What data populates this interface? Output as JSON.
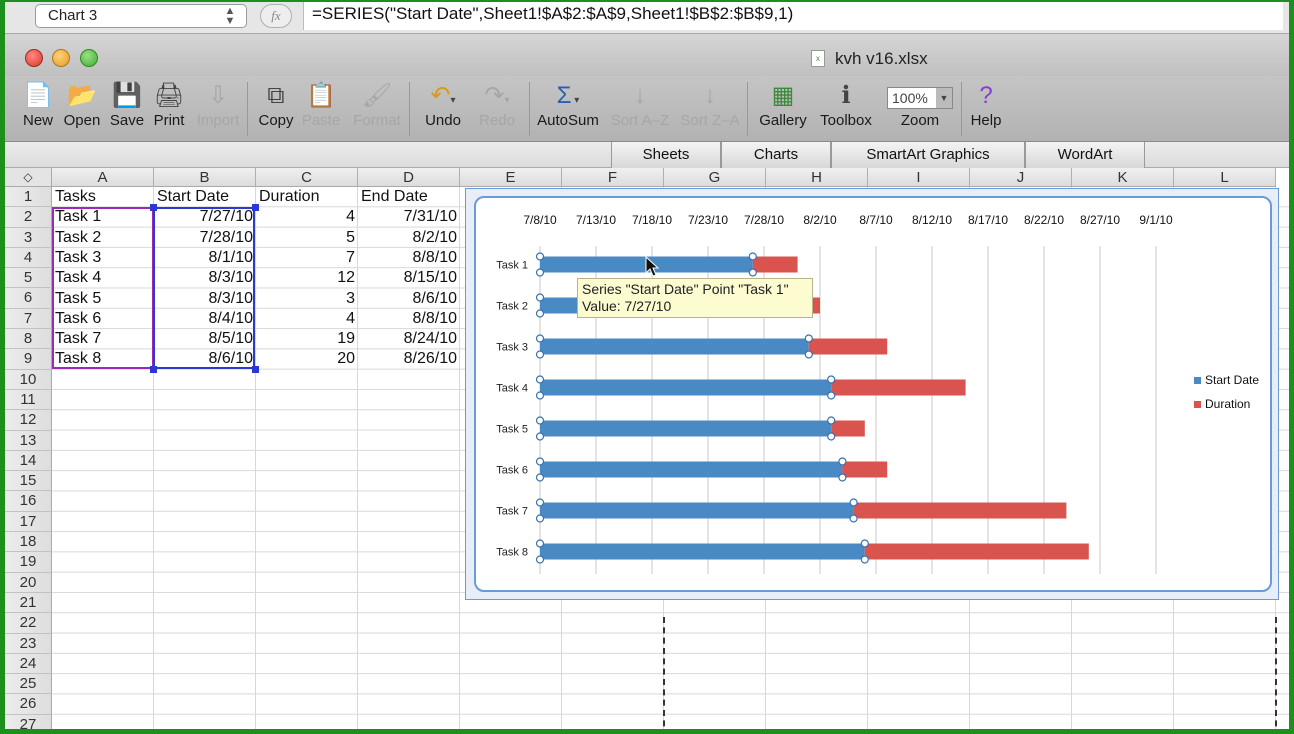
{
  "formula_bar": {
    "name_box": "Chart 3",
    "fx": "fx",
    "formula": "=SERIES(\"Start Date\",Sheet1!$A$2:$A$9,Sheet1!$B$2:$B$9,1)"
  },
  "window": {
    "title": "kvh v16.xlsx"
  },
  "toolbar": {
    "new": "New",
    "open": "Open",
    "save": "Save",
    "print": "Print",
    "import": "Import",
    "copy": "Copy",
    "paste": "Paste",
    "format": "Format",
    "undo": "Undo",
    "redo": "Redo",
    "autosum": "AutoSum",
    "sort_az": "Sort A–Z",
    "sort_za": "Sort Z–A",
    "gallery": "Gallery",
    "toolbox": "Toolbox",
    "zoom_label": "Zoom",
    "zoom_value": "100%",
    "help": "Help"
  },
  "ribbon": {
    "tabs": [
      "Sheets",
      "Charts",
      "SmartArt Graphics",
      "WordArt"
    ]
  },
  "columns": [
    "A",
    "B",
    "C",
    "D",
    "E",
    "F",
    "G",
    "H",
    "I",
    "J",
    "K",
    "L"
  ],
  "rows": [
    "1",
    "2",
    "3",
    "4",
    "5",
    "6",
    "7",
    "8",
    "9",
    "10",
    "11",
    "12",
    "13",
    "14",
    "15",
    "16",
    "17",
    "18",
    "19",
    "20",
    "21",
    "22",
    "23",
    "24",
    "25",
    "26",
    "27"
  ],
  "sheet": {
    "header": [
      "Tasks",
      "Start Date",
      "Duration",
      "End Date"
    ],
    "data": [
      [
        "Task 1",
        "7/27/10",
        "4",
        "7/31/10"
      ],
      [
        "Task 2",
        "7/28/10",
        "5",
        "8/2/10"
      ],
      [
        "Task 3",
        "8/1/10",
        "7",
        "8/8/10"
      ],
      [
        "Task 4",
        "8/3/10",
        "12",
        "8/15/10"
      ],
      [
        "Task 5",
        "8/3/10",
        "3",
        "8/6/10"
      ],
      [
        "Task 6",
        "8/4/10",
        "4",
        "8/8/10"
      ],
      [
        "Task 7",
        "8/5/10",
        "19",
        "8/24/10"
      ],
      [
        "Task 8",
        "8/6/10",
        "20",
        "8/26/10"
      ]
    ]
  },
  "tooltip": {
    "line1": "Series \"Start Date\" Point \"Task 1\"",
    "line2": "Value: 7/27/10"
  },
  "chart_data": {
    "type": "bar",
    "orientation": "horizontal-stacked",
    "categories": [
      "Task 1",
      "Task 2",
      "Task 3",
      "Task 4",
      "Task 5",
      "Task 6",
      "Task 7",
      "Task 8"
    ],
    "x_tick_labels": [
      "7/8/10",
      "7/13/10",
      "7/18/10",
      "7/23/10",
      "7/28/10",
      "8/2/10",
      "8/7/10",
      "8/12/10",
      "8/17/10",
      "8/22/10",
      "8/27/10",
      "9/1/10"
    ],
    "xlim": [
      "7/8/10",
      "9/1/10"
    ],
    "x_axis_position": "top",
    "grid": true,
    "legend": "right",
    "series": [
      {
        "name": "Start Date",
        "color": "#4a8ac4",
        "values": [
          "7/27/10",
          "7/28/10",
          "8/1/10",
          "8/3/10",
          "8/3/10",
          "8/4/10",
          "8/5/10",
          "8/6/10"
        ]
      },
      {
        "name": "Duration",
        "color": "#d9534f",
        "values": [
          4,
          5,
          7,
          12,
          3,
          4,
          19,
          20
        ]
      }
    ]
  }
}
